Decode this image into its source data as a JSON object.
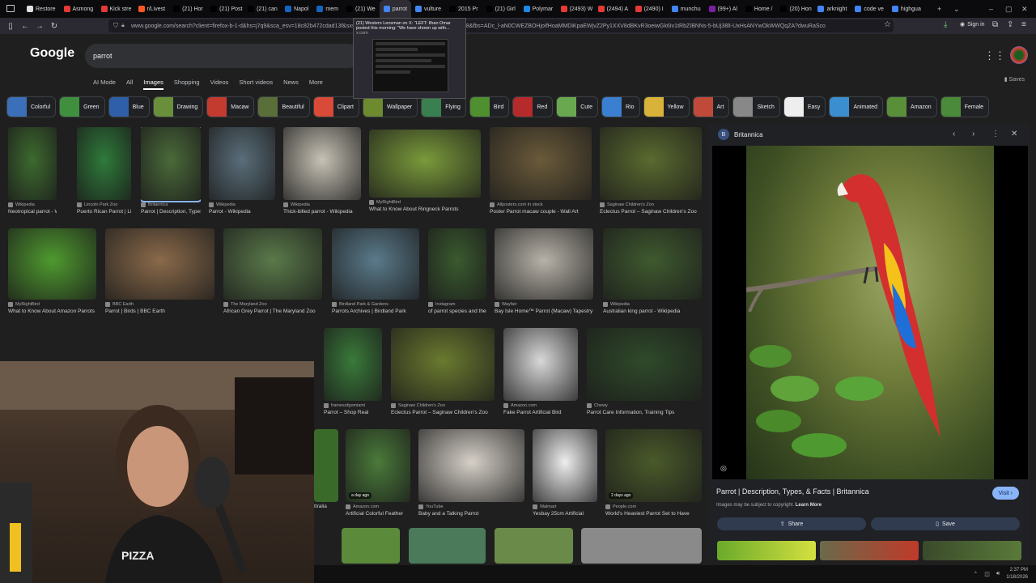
{
  "browser": {
    "tabs": [
      {
        "label": "Restore",
        "color": "#e0e0e0"
      },
      {
        "label": "Asmong",
        "color": "#e53935"
      },
      {
        "label": "Kick stre",
        "color": "#e53935"
      },
      {
        "label": "r/Livest",
        "color": "#ff5722"
      },
      {
        "label": "(21) Hor",
        "color": "#000000"
      },
      {
        "label": "(21) Post",
        "color": "#000000"
      },
      {
        "label": "(21) can",
        "color": "#000000"
      },
      {
        "label": "Napol",
        "color": "#1565c0"
      },
      {
        "label": "mem",
        "color": "#1565c0"
      },
      {
        "label": "(21) We",
        "color": "#000000"
      },
      {
        "label": "parrot",
        "color": "#4285f4"
      },
      {
        "label": "vulture",
        "color": "#4285f4"
      },
      {
        "label": "2015 Pr",
        "color": "#000000"
      },
      {
        "label": "(21) Girl",
        "color": "#000000"
      },
      {
        "label": "Polymar",
        "color": "#1e88e5"
      },
      {
        "label": "(2493) W",
        "color": "#e53935"
      },
      {
        "label": "(2494) A",
        "color": "#e53935"
      },
      {
        "label": "(2490) I",
        "color": "#e53935"
      },
      {
        "label": "munchu",
        "color": "#4285f4"
      },
      {
        "label": "(99+) Al",
        "color": "#7b1fa2"
      },
      {
        "label": "Home /",
        "color": "#000000"
      },
      {
        "label": "(20) Hon",
        "color": "#000000"
      },
      {
        "label": "arknight",
        "color": "#4285f4"
      },
      {
        "label": "code ve",
        "color": "#4285f4"
      },
      {
        "label": "highgua",
        "color": "#4285f4"
      }
    ],
    "url": "www.google.com/search?client=firefox-b-1-d&hs=j7q9&sca_esv=18c82b472cdad13f&sxsrf=...&udm=2&ei=...1768768534050&udm=28&fbs=ADc_l-aN0CWEZBOHjoIfHoaMMDiKpaEWjvZ2Py1XXV8dBKvR3oeiwGk6Iv1tRbZIBNNs-5-bUj38lI-UxHsANYwOkWWQqZA?dwuRaSco",
    "sign_in": "Sign in",
    "tooltip": {
      "title": "(21) Western Lensman on X: \"LEFT: Ilhan Omar posted this morning: \"We have shown up with...",
      "site": "x.com"
    }
  },
  "google": {
    "logo": "Google",
    "query": "parrot",
    "tabs": [
      "AI Mode",
      "All",
      "Images",
      "Shopping",
      "Videos",
      "Short videos",
      "News",
      "More"
    ],
    "active_tab": "Images",
    "saves": "Saves",
    "chips": [
      {
        "label": "Colorful",
        "color": "#3b6fb8"
      },
      {
        "label": "Green",
        "color": "#3f8f3f"
      },
      {
        "label": "Blue",
        "color": "#2f5fa8"
      },
      {
        "label": "Drawing",
        "color": "#6a8f3a"
      },
      {
        "label": "Macaw",
        "color": "#c33b2f"
      },
      {
        "label": "Beautiful",
        "color": "#5a6e3a"
      },
      {
        "label": "Clipart",
        "color": "#d94a38"
      },
      {
        "label": "Wallpaper",
        "color": "#6d8a2f"
      },
      {
        "label": "Flying",
        "color": "#3a7f4f"
      },
      {
        "label": "Bird",
        "color": "#4f8f2f"
      },
      {
        "label": "Red",
        "color": "#b52a2a"
      },
      {
        "label": "Cute",
        "color": "#6aa84f"
      },
      {
        "label": "Rio",
        "color": "#3b7fd0"
      },
      {
        "label": "Yellow",
        "color": "#d9b23a"
      },
      {
        "label": "Art",
        "color": "#c04a3a"
      },
      {
        "label": "Sketch",
        "color": "#888888"
      },
      {
        "label": "Easy",
        "color": "#eeeeee"
      },
      {
        "label": "Animated",
        "color": "#3b8ed0"
      },
      {
        "label": "Amazon",
        "color": "#5a8f3a"
      },
      {
        "label": "Female",
        "color": "#4a8a3a"
      }
    ],
    "results": [
      {
        "src": "Wikipedia",
        "title": "Neotropical parrot - Wikipedia",
        "color": "#3d6a2f"
      },
      {
        "src": "Lincoln Park Zoo",
        "title": "Puerto Rican Parrot | Lincoln Park Zoo",
        "color": "#2f7a3a"
      },
      {
        "src": "Britannica",
        "title": "Parrot | Description, Types, & Facts | Britannica",
        "color": "#4a6a3a"
      },
      {
        "src": "Wikipedia",
        "title": "Parrot - Wikipedia",
        "color": "#5a6e7a"
      },
      {
        "src": "Wikipedia",
        "title": "Thick-billed parrot - Wikipedia",
        "color": "#c7c2b5"
      },
      {
        "src": "MyRightBird",
        "title": "What to Know About Ringneck Parrots",
        "color": "#7a9a3a"
      },
      {
        "src": "Allposters.com  In stock",
        "title": "Poster Parrot macaw couple - Wall Art",
        "color": "#6a5a3a"
      },
      {
        "src": "Saginaw Children's Zoo",
        "title": "Eclectus Parrot – Saginaw Children's Zoo",
        "color": "#5a6a2f"
      },
      {
        "src": "MyRightBird",
        "title": "What to Know About Amazon Parrots",
        "color": "#4f9a2f"
      },
      {
        "src": "BBC Earth",
        "title": "Parrot | Birds | BBC Earth",
        "color": "#8a6a4a"
      },
      {
        "src": "The Maryland Zoo",
        "title": "African Grey Parrot | The Maryland Zoo",
        "color": "#5a7a4a"
      },
      {
        "src": "Birdland Park & Gardens",
        "title": "Parrots Archives | Birdland Park",
        "color": "#5a7a8a"
      },
      {
        "src": "Instagram",
        "title": "of parrot species and their",
        "color": "#3a5a2f"
      },
      {
        "src": "Wayfair",
        "title": "Bay Isle Home™ Parrot (Macaw) Tapestry",
        "color": "#b7b2a8"
      },
      {
        "src": "Wikipedia",
        "title": "Australian king parrot - Wikipedia",
        "color": "#3f5a2f"
      },
      {
        "src": "framesofgomiami",
        "title": "Parrot – Shop Real",
        "color": "#3a7a3a"
      },
      {
        "src": "Saginaw Children's Zoo",
        "title": "Eclectus Parrot – Saginaw Children's Zoo",
        "color": "#6a7a2f"
      },
      {
        "src": "Amazon.com",
        "title": "Fake Parrot Artificial Bird",
        "color": "#d8d8d8"
      },
      {
        "src": "Chewy",
        "title": "Parrot Care Information, Training Tips",
        "color": "#2f4a2a"
      },
      {
        "src": "Amazon.com",
        "title": "Artificial Colorful Feather",
        "color": "#4a7a3a"
      },
      {
        "src": "YouTube",
        "title": "Baby and a Talking Parrot",
        "color": "#d6d0c8"
      },
      {
        "src": "Walmart",
        "title": "Yesbay 25cm Artificial",
        "color": "#eeeeee"
      },
      {
        "src": "People.com",
        "title": "World's Heaviest Parrot Set to Have",
        "color": "#4a5a2a"
      }
    ],
    "badges": {
      "r20": "a day ago",
      "r22": "2 days ago",
      "pinned": "ttralia"
    },
    "panel": {
      "site": "Britannica",
      "title": "Parrot | Description, Types, & Facts | Britannica",
      "note": "Images may be subject to copyright.",
      "learn_more": "Learn More",
      "visit": "Visit",
      "share": "Share",
      "save": "Save"
    }
  },
  "overlay": {
    "shirt_text": "PIZZA"
  },
  "taskbar": {
    "time": "2:37 PM",
    "date": "1/18/2026"
  }
}
